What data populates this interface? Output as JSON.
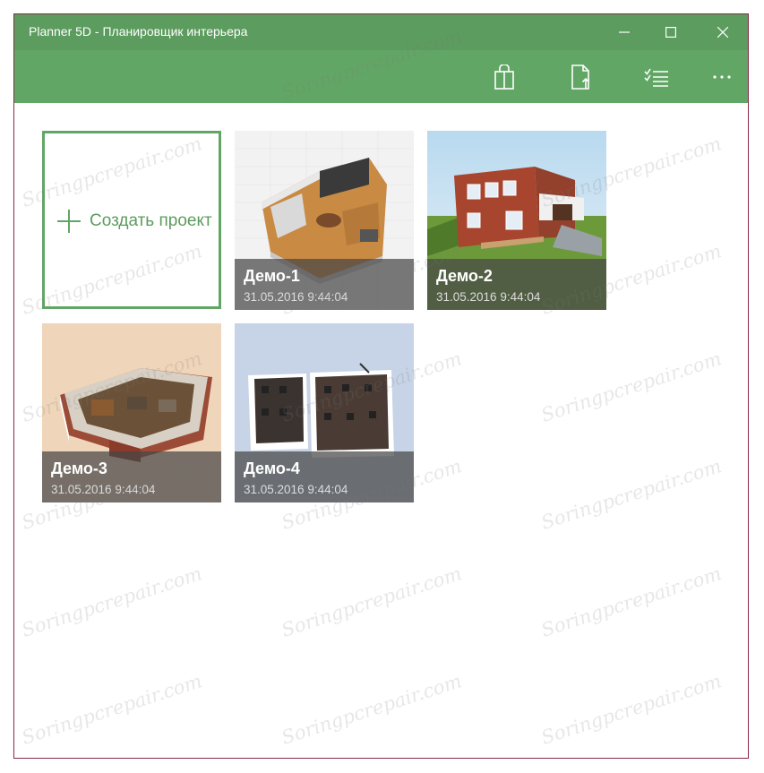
{
  "window": {
    "title": "Planner 5D - Планировщик интерьера",
    "controls": {
      "minimize": "minimize-icon",
      "maximize": "maximize-icon",
      "close": "close-icon"
    }
  },
  "toolbar": {
    "buttons": [
      {
        "icon": "shopping-bag-icon"
      },
      {
        "icon": "import-file-icon"
      },
      {
        "icon": "select-list-icon"
      },
      {
        "icon": "more-icon"
      }
    ],
    "background": "#62a665",
    "titlebar_background": "#5c9c5e"
  },
  "create_tile": {
    "label": "Создать проект",
    "icon": "plus-icon",
    "accent": "#62a665"
  },
  "projects": [
    {
      "name": "Демо-1",
      "date": "31.05.2016 9:44:04"
    },
    {
      "name": "Демо-2",
      "date": "31.05.2016 9:44:04"
    },
    {
      "name": "Демо-3",
      "date": "31.05.2016 9:44:04"
    },
    {
      "name": "Демо-4",
      "date": "31.05.2016 9:44:04"
    }
  ],
  "watermark": "Soringpcrepair.com"
}
